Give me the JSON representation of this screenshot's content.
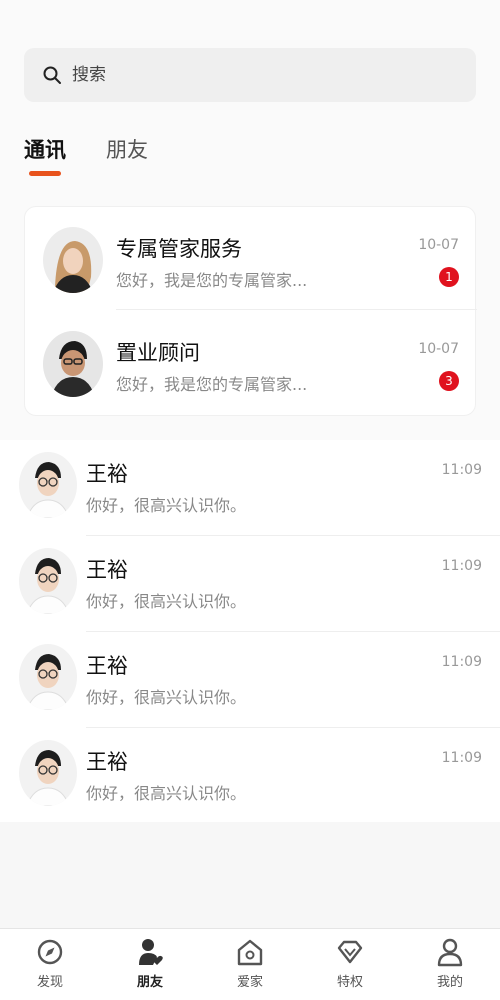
{
  "search": {
    "placeholder": "搜索"
  },
  "tabs": [
    {
      "label": "通讯",
      "active": true
    },
    {
      "label": "朋友",
      "active": false
    }
  ],
  "pinned": [
    {
      "name": "专属管家服务",
      "preview": "您好，我是您的专属管家...",
      "time": "10-07",
      "unread": "1"
    },
    {
      "name": "置业顾问",
      "preview": "您好，我是您的专属管家...",
      "time": "10-07",
      "unread": "3"
    }
  ],
  "contacts": [
    {
      "name": "王裕",
      "preview": "你好，很高兴认识你。",
      "time": "11:09"
    },
    {
      "name": "王裕",
      "preview": "你好，很高兴认识你。",
      "time": "11:09"
    },
    {
      "name": "王裕",
      "preview": "你好，很高兴认识你。",
      "time": "11:09"
    },
    {
      "name": "王裕",
      "preview": "你好，很高兴认识你。",
      "time": "11:09"
    }
  ],
  "nav": [
    {
      "label": "发现",
      "icon": "compass-icon",
      "active": false
    },
    {
      "label": "朋友",
      "icon": "friends-icon",
      "active": true
    },
    {
      "label": "爱家",
      "icon": "home-icon",
      "active": false
    },
    {
      "label": "特权",
      "icon": "diamond-icon",
      "active": false
    },
    {
      "label": "我的",
      "icon": "profile-icon",
      "active": false
    }
  ],
  "colors": {
    "accent": "#e8531d",
    "badge": "#e0121e"
  }
}
